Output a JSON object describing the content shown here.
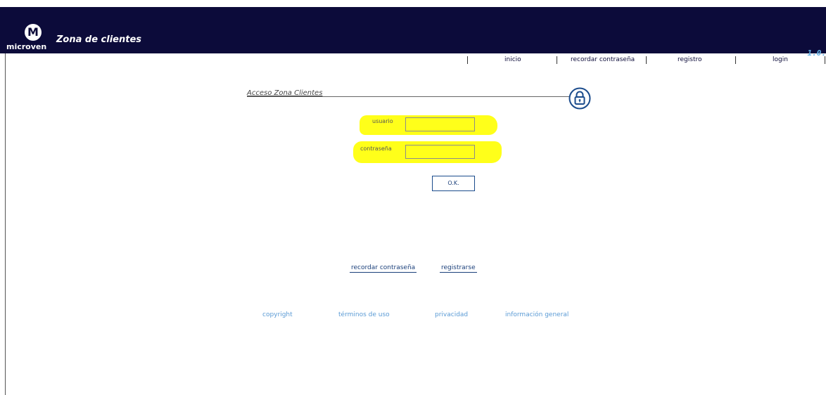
{
  "header": {
    "logo_text": "microven",
    "logo_letter": "M",
    "title": "Zona de clientes",
    "version": "1.0."
  },
  "nav": {
    "items": [
      {
        "label": "inicio"
      },
      {
        "label": "recordar contraseña"
      },
      {
        "label": "registro"
      },
      {
        "label": "login"
      }
    ]
  },
  "section": {
    "title": "Acceso Zona Clientes",
    "icon": "lock-icon"
  },
  "form": {
    "username_label": "usuario",
    "username_value": "",
    "password_label": "contraseña",
    "password_value": "",
    "submit_label": "O.K."
  },
  "links": {
    "forgot_password": "recordar contraseña",
    "register": "registrarse"
  },
  "footer": {
    "items": [
      {
        "label": "copyright"
      },
      {
        "label": "términos de uso"
      },
      {
        "label": "privacidad"
      },
      {
        "label": "información general"
      }
    ]
  },
  "colors": {
    "header_bg": "#0c0b3a",
    "highlight": "#ffff1a",
    "link": "#1a3f7a",
    "footer_link": "#5b9bd5",
    "version": "#5fb0e6"
  }
}
